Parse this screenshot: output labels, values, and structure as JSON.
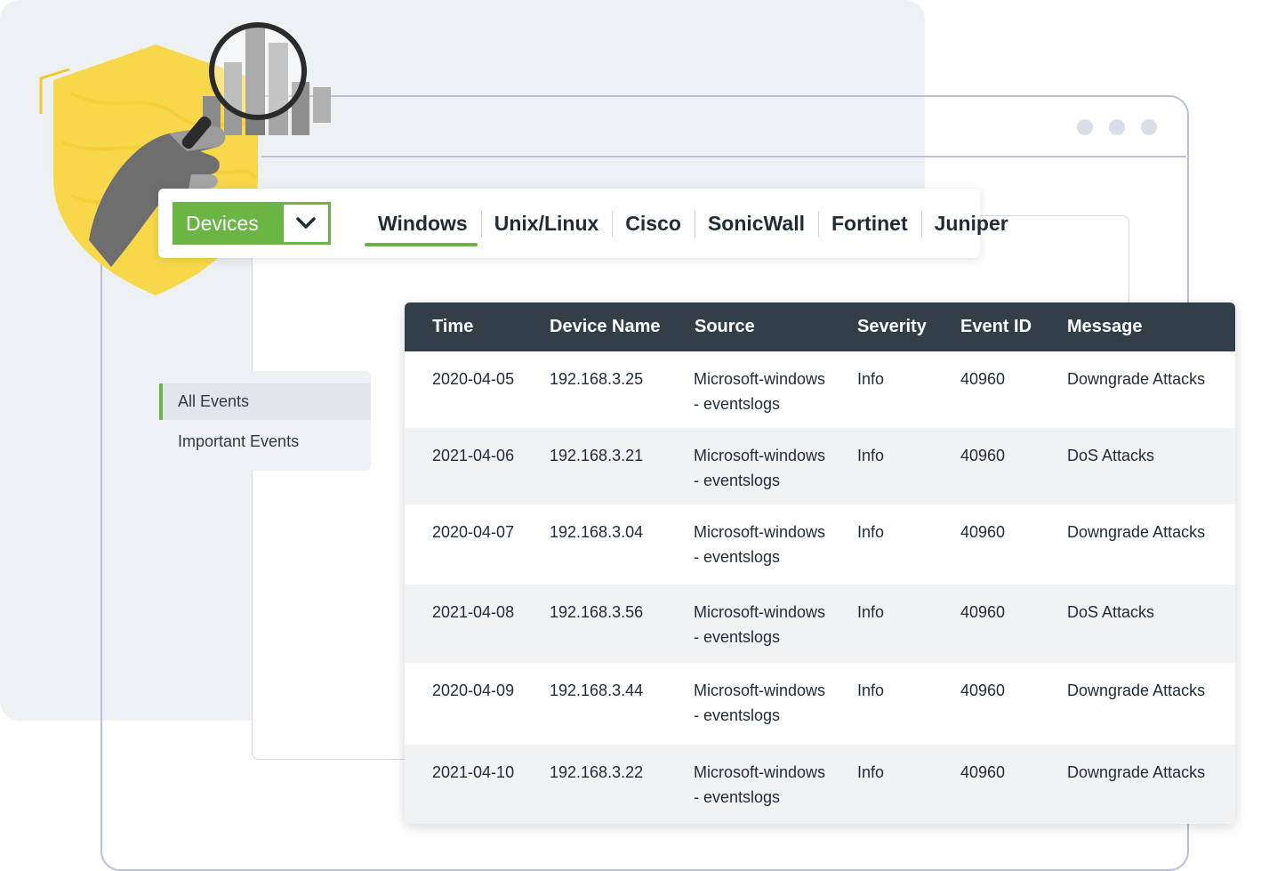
{
  "window": {
    "title_dots": [
      "",
      "",
      ""
    ]
  },
  "device_bar": {
    "dropdown_label": "Devices",
    "tabs": [
      {
        "label": "Windows",
        "active": true
      },
      {
        "label": "Unix/Linux",
        "active": false
      },
      {
        "label": "Cisco",
        "active": false
      },
      {
        "label": "SonicWall",
        "active": false
      },
      {
        "label": "Fortinet",
        "active": false
      },
      {
        "label": "Juniper",
        "active": false
      }
    ]
  },
  "side_menu": {
    "items": [
      {
        "label": "All Events",
        "active": true
      },
      {
        "label": "Important Events",
        "active": false
      }
    ]
  },
  "table": {
    "headers": [
      "Time",
      "Device Name",
      "Source",
      "Severity",
      "Event ID",
      "Message"
    ],
    "rows": [
      {
        "time": "2020-04-05",
        "device": "192.168.3.25",
        "source_1": "Microsoft-windows",
        "source_2": "- eventslogs",
        "severity": "Info",
        "event_id": "40960",
        "message": "Downgrade Attacks"
      },
      {
        "time": "2021-04-06",
        "device": "192.168.3.21",
        "source_1": "Microsoft-windows",
        "source_2": "- eventslogs",
        "severity": "Info",
        "event_id": "40960",
        "message": "DoS Attacks"
      },
      {
        "time": "2020-04-07",
        "device": "192.168.3.04",
        "source_1": "Microsoft-windows",
        "source_2": "- eventslogs",
        "severity": "Info",
        "event_id": "40960",
        "message": "Downgrade Attacks"
      },
      {
        "time": "2021-04-08",
        "device": "192.168.3.56",
        "source_1": "Microsoft-windows",
        "source_2": "- eventslogs",
        "severity": "Info",
        "event_id": "40960",
        "message": "DoS Attacks"
      },
      {
        "time": "2020-04-09",
        "device": "192.168.3.44",
        "source_1": "Microsoft-windows",
        "source_2": "- eventslogs",
        "severity": "Info",
        "event_id": "40960",
        "message": "Downgrade Attacks"
      },
      {
        "time": "2021-04-10",
        "device": "192.168.3.22",
        "source_1": "Microsoft-windows",
        "source_2": "- eventslogs",
        "severity": "Info",
        "event_id": "40960",
        "message": "Downgrade Attacks"
      }
    ]
  },
  "colors": {
    "accent": "#6bb545",
    "header_bg": "#333f48",
    "shield": "#f7d84a",
    "frame": "#b9bfdc"
  },
  "icons": [
    "shield-icon",
    "magnifier-icon",
    "bar-chart-icon",
    "chevron-down-icon"
  ]
}
